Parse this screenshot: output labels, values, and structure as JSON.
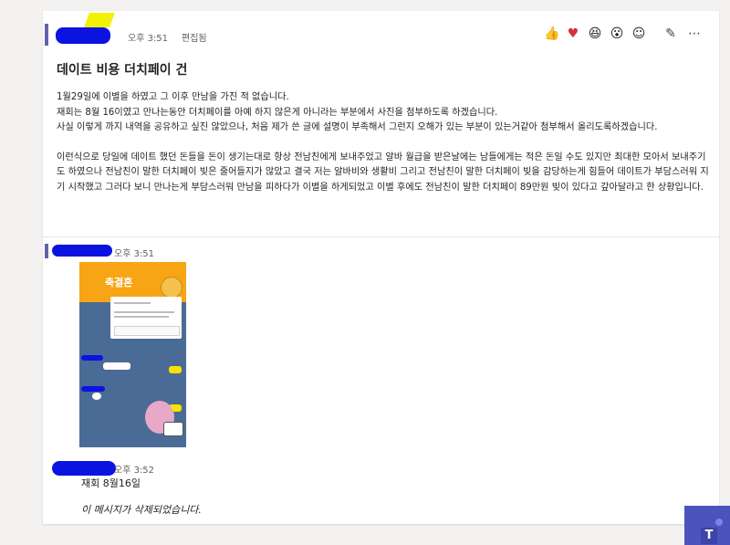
{
  "post": {
    "time": "오후 3:51",
    "edited": "편집됨",
    "title": "데이트 비용 더치페이 건",
    "paragraphs": [
      "1월29일에 이별을 하였고 그 이후 만남을 가진 적 없습니다.",
      "재회는 8월 16이였고 만나는동안 더치페이를 아예 하지 않은게 아니라는 부분에서 사진을 첨부하도록 하겠습니다.",
      "사실 이렇게 까지 내역을 공유하고 싶진 않았으나, 처음 제가 쓴 글에 설명이 부족해서 그런지 오해가 있는 부분이 있는거같아 첨부해서 올리도록하겠습니다.",
      "",
      "이런식으로 당일에 데이트 했던 돈들을 돈이 생기는대로 항상 전남친에게 보내주었고 알바 월급을 받은날에는 남들에게는 적은 돈일 수도 있지만 최대한 모아서 보내주기도 하였으나 전남친이 말한 더치페이 빚은 줄어들지가 않았고 결국 저는 알바비와 생활비 그리고 전남친이 말한 더치페이 빚을 감당하는게 힘들어 데이트가 부담스러워 지기 시작했고 그러다 보니 만나는게 부담스러워 만남을 피하다가 이별을 하게되었고 이별 후에도 전남친이 말한 더치페이 89만원 빚이 있다고 갚아달라고 한 상황입니다."
    ],
    "reactions": [
      "like-icon",
      "heart-icon",
      "laugh-icon",
      "surprised-icon",
      "add-reaction-icon"
    ]
  },
  "reply1": {
    "time": "오후 3:51",
    "image": {
      "banner_title": "축결혼"
    }
  },
  "reply2": {
    "time": "오후 3:52",
    "text": "재회 8월16일",
    "deleted": "이 메시지가 삭제되었습니다."
  },
  "colors": {
    "accent": "#6264a7",
    "redaction_blue": "#0a13e0",
    "redaction_yellow": "#f2f200",
    "teams_tile": "#4b53bc"
  },
  "app_tile": {
    "letter": "T"
  }
}
